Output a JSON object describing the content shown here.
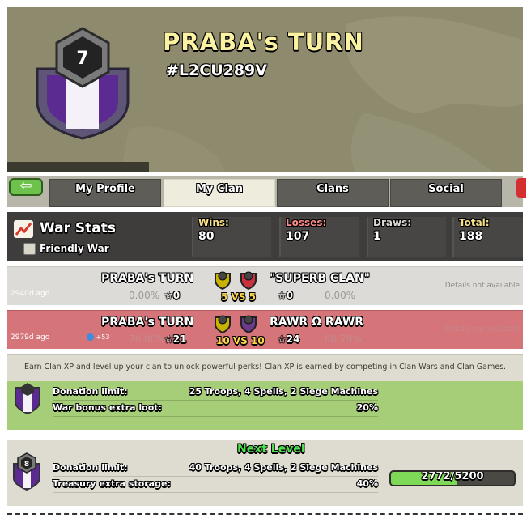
{
  "header": {
    "clan_level": "7",
    "clan_name": "PRABA's TURN",
    "clan_tag": "#L2CU289V"
  },
  "tabs": [
    {
      "label": "My Profile",
      "active": false
    },
    {
      "label": "My Clan",
      "active": true
    },
    {
      "label": "Clans",
      "active": false
    },
    {
      "label": "Social",
      "active": false
    }
  ],
  "war_stats": {
    "title": "War Stats",
    "friendly_war_label": "Friendly War",
    "wins_label": "Wins:",
    "wins": "80",
    "losses_label": "Losses:",
    "losses": "107",
    "draws_label": "Draws:",
    "draws": "1",
    "total_label": "Total:",
    "total": "188"
  },
  "wars": [
    {
      "ago": "2940d ago",
      "clan1": "PRABA's TURN",
      "clan1_percent": "0.00%",
      "clan1_stars": "0",
      "vs": "5 VS 5",
      "clan2": "\"SUPERB CLAN\"",
      "clan2_stars": "0",
      "clan2_percent": "0.00%",
      "details": "Details not available",
      "result": "draw"
    },
    {
      "ago": "2979d ago",
      "xp_gained": "+53",
      "clan1": "PRABA's TURN",
      "clan1_percent": "76.00%",
      "clan1_stars": "21",
      "vs": "10 VS 10",
      "clan2": "RAWR Ω RAWR",
      "clan2_stars": "24",
      "clan2_percent": "80.70%",
      "details": "Details not available",
      "result": "loss"
    }
  ],
  "perks_description": "Earn Clan XP and level up your clan to unlock powerful perks! Clan XP is earned by competing in Clan Wars and Clan Games.",
  "current_level": {
    "donation_label": "Donation limit:",
    "donation_value": "25 Troops, 4 Spells, 2 Siege Machines",
    "bonus_label": "War bonus extra loot:",
    "bonus_value": "20%"
  },
  "next_level": {
    "title": "Next Level",
    "level": "8",
    "donation_label": "Donation limit:",
    "donation_value": "40 Troops, 4 Spells, 2 Siege Machines",
    "treasury_label": "Treasury extra storage:",
    "treasury_value": "40%",
    "xp_text": "2772/5200",
    "xp_current": 2772,
    "xp_required": 5200
  },
  "colors": {
    "clan_name": "#fbf3a2",
    "wins_label": "#f6e08a",
    "losses_label": "#ff8a8a",
    "draws_label": "#d9d7cf",
    "total_label": "#f6e08a",
    "loss_row": "#d5757a",
    "current_level_bg": "#a6cd78",
    "next_level_title": "#4ee04e"
  }
}
